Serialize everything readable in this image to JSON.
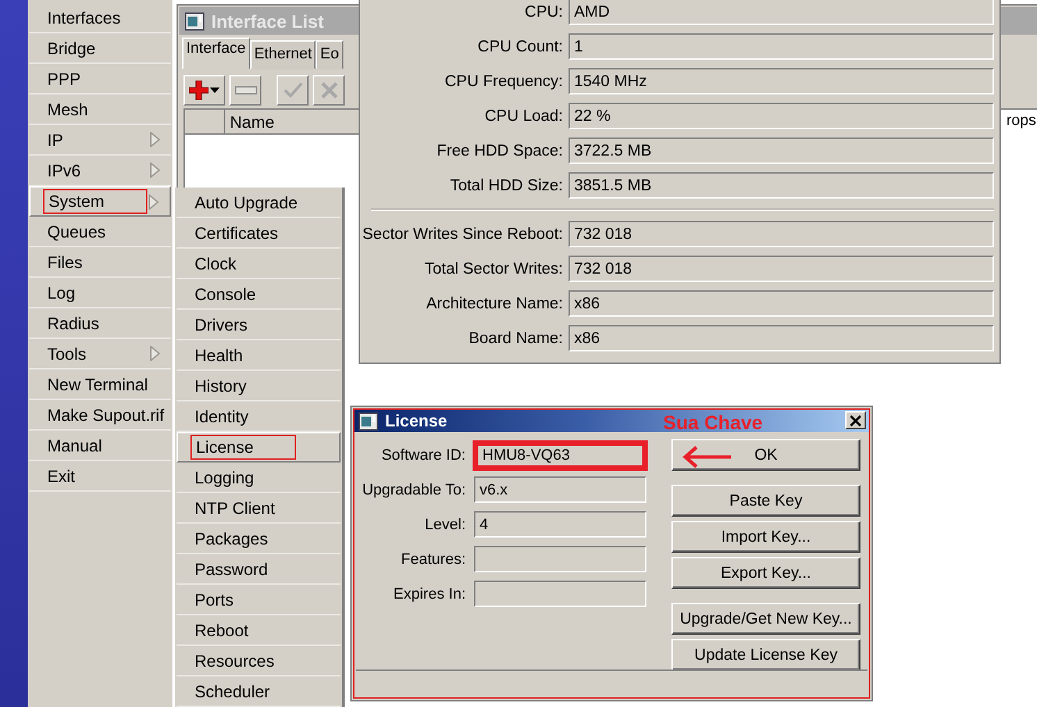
{
  "main_menu": {
    "items": [
      {
        "label": "Interfaces",
        "has_submenu": false,
        "selected": false
      },
      {
        "label": "Bridge",
        "has_submenu": false,
        "selected": false
      },
      {
        "label": "PPP",
        "has_submenu": false,
        "selected": false
      },
      {
        "label": "Mesh",
        "has_submenu": false,
        "selected": false
      },
      {
        "label": "IP",
        "has_submenu": true,
        "selected": false
      },
      {
        "label": "IPv6",
        "has_submenu": true,
        "selected": false
      },
      {
        "label": "System",
        "has_submenu": true,
        "selected": true
      },
      {
        "label": "Queues",
        "has_submenu": false,
        "selected": false
      },
      {
        "label": "Files",
        "has_submenu": false,
        "selected": false
      },
      {
        "label": "Log",
        "has_submenu": false,
        "selected": false
      },
      {
        "label": "Radius",
        "has_submenu": false,
        "selected": false
      },
      {
        "label": "Tools",
        "has_submenu": true,
        "selected": false
      },
      {
        "label": "New Terminal",
        "has_submenu": false,
        "selected": false
      },
      {
        "label": "Make Supout.rif",
        "has_submenu": false,
        "selected": false
      },
      {
        "label": "Manual",
        "has_submenu": false,
        "selected": false
      },
      {
        "label": "Exit",
        "has_submenu": false,
        "selected": false
      }
    ]
  },
  "submenu": {
    "items": [
      {
        "label": "Auto Upgrade",
        "selected": false
      },
      {
        "label": "Certificates",
        "selected": false
      },
      {
        "label": "Clock",
        "selected": false
      },
      {
        "label": "Console",
        "selected": false
      },
      {
        "label": "Drivers",
        "selected": false
      },
      {
        "label": "Health",
        "selected": false
      },
      {
        "label": "History",
        "selected": false
      },
      {
        "label": "Identity",
        "selected": false
      },
      {
        "label": "License",
        "selected": true
      },
      {
        "label": "Logging",
        "selected": false
      },
      {
        "label": "NTP Client",
        "selected": false
      },
      {
        "label": "Packages",
        "selected": false
      },
      {
        "label": "Password",
        "selected": false
      },
      {
        "label": "Ports",
        "selected": false
      },
      {
        "label": "Reboot",
        "selected": false
      },
      {
        "label": "Resources",
        "selected": false
      },
      {
        "label": "Scheduler",
        "selected": false
      }
    ]
  },
  "interface_list": {
    "title": "Interface List",
    "tabs": [
      {
        "label": "Interface",
        "selected": true
      },
      {
        "label": "Ethernet",
        "selected": false
      },
      {
        "label": "Eo",
        "selected": false
      }
    ],
    "columns": [
      "Name",
      "rops"
    ]
  },
  "resources": {
    "groups": [
      [
        {
          "label": "CPU:",
          "value": "AMD"
        },
        {
          "label": "CPU Count:",
          "value": "1"
        },
        {
          "label": "CPU Frequency:",
          "value": "1540 MHz"
        },
        {
          "label": "CPU Load:",
          "value": "22 %"
        },
        {
          "label": "Free HDD Space:",
          "value": "3722.5 MB"
        },
        {
          "label": "Total HDD Size:",
          "value": "3851.5 MB"
        }
      ],
      [
        {
          "label": "Sector Writes Since Reboot:",
          "value": "732 018"
        },
        {
          "label": "Total Sector Writes:",
          "value": "732 018"
        },
        {
          "label": "Architecture Name:",
          "value": "x86"
        },
        {
          "label": "Board Name:",
          "value": "x86"
        }
      ]
    ]
  },
  "license": {
    "title": "License",
    "annotation": "Sua Chave",
    "fields": [
      {
        "label": "Software ID:",
        "value": "HMU8-VQ63",
        "highlighted": true
      },
      {
        "label": "Upgradable To:",
        "value": "v6.x",
        "highlighted": false
      },
      {
        "label": "Level:",
        "value": "4",
        "highlighted": false
      },
      {
        "label": "Features:",
        "highlighted": false
      },
      {
        "label": "Expires In:",
        "highlighted": false
      }
    ],
    "buttons": [
      {
        "label": "OK"
      },
      {
        "label": "Paste Key"
      },
      {
        "label": "Import Key..."
      },
      {
        "label": "Export Key..."
      },
      {
        "label": "Upgrade/Get New Key..."
      },
      {
        "label": "Update License Key"
      }
    ]
  }
}
